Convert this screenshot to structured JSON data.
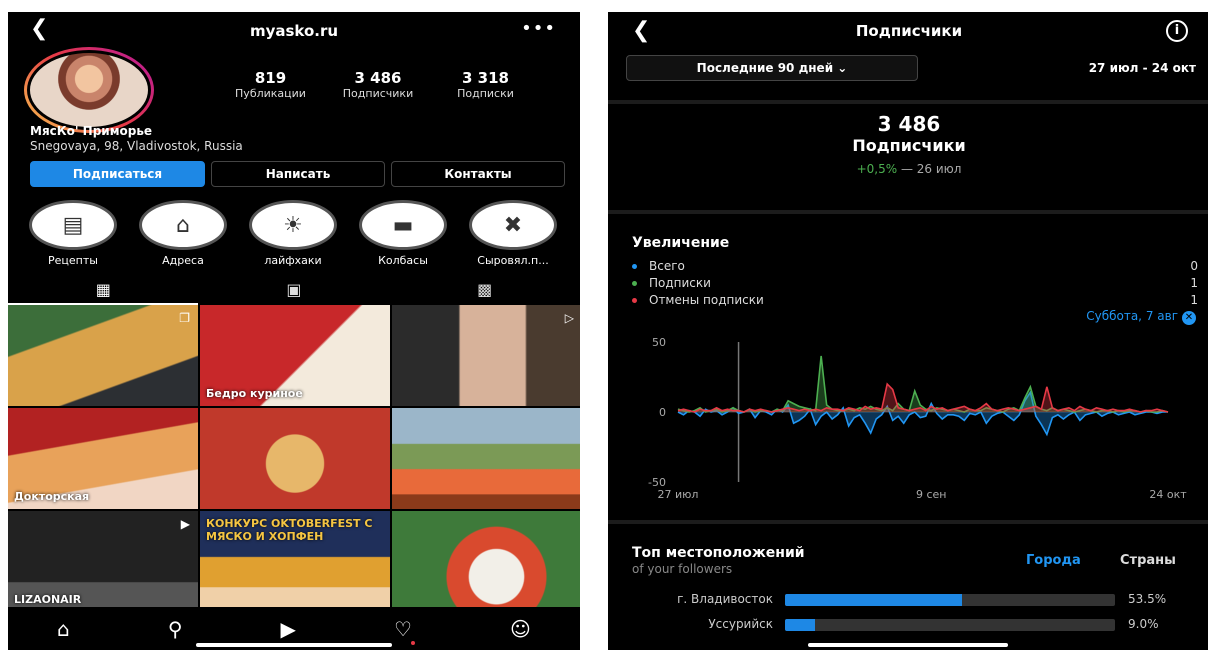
{
  "profile": {
    "username": "myasko.ru",
    "stats": [
      {
        "value": "819",
        "label": "Публикации"
      },
      {
        "value": "3 486",
        "label": "Подписчики"
      },
      {
        "value": "3 318",
        "label": "Подписки"
      }
    ],
    "name": "МясКо' Приморье",
    "address": "Snegovaya, 98, Vladivostok, Russia",
    "buttons": {
      "follow": "Подписаться",
      "message": "Написать",
      "contacts": "Контакты"
    },
    "highlights": [
      {
        "label": "Рецепты",
        "icon": "book-icon"
      },
      {
        "label": "Адреса",
        "icon": "home-icon"
      },
      {
        "label": "лайфхаки",
        "icon": "lightbulb-icon"
      },
      {
        "label": "Колбасы",
        "icon": "sausage-icon"
      },
      {
        "label": "Сыровял.п...",
        "icon": "cross-icon"
      }
    ],
    "tiles": [
      {
        "caption": "",
        "badge": "multi-icon"
      },
      {
        "caption": "Бедро куриное",
        "badge": ""
      },
      {
        "caption": "",
        "badge": "reel-icon"
      },
      {
        "caption": "Докторская",
        "badge": ""
      },
      {
        "caption": "",
        "badge": ""
      },
      {
        "caption": "",
        "badge": ""
      },
      {
        "caption": "LIZAONAIR",
        "badge": "play-icon"
      },
      {
        "caption": "КОНКУРС OKTOBERFEST С МЯСКО И ХОПФЕН",
        "badge": ""
      },
      {
        "caption": "",
        "badge": ""
      }
    ]
  },
  "followers": {
    "title": "Подписчики",
    "period": "Последние 90 дней ⌄",
    "range": "27 июл - 24 окт",
    "total": "3 486",
    "total_label": "Подписчики",
    "delta": "+0,5%",
    "delta_suffix": " — 26 июл",
    "growth_title": "Увеличение",
    "legend": [
      {
        "label": "Всего",
        "value": "0",
        "color": "#2196f3"
      },
      {
        "label": "Подписки",
        "value": "1",
        "color": "#4caf50"
      },
      {
        "label": "Отмены подписки",
        "value": "1",
        "color": "#e63946"
      }
    ],
    "selected_date": "Суббота, 7 авг",
    "locations_title": "Топ местоположений",
    "locations_subtitle": "of your followers",
    "location_tabs": [
      "Города",
      "Страны"
    ],
    "locations": [
      {
        "name": "г. Владивосток",
        "pct": "53.5%",
        "value": 53.5
      },
      {
        "name": "Уссурийск",
        "pct": "9.0%",
        "value": 9.0
      }
    ]
  },
  "chart_data": {
    "type": "line",
    "xlabel": "",
    "ylabel": "",
    "x_ticks": [
      "27 июл",
      "9 сен",
      "24 окт"
    ],
    "y_ticks": [
      "50",
      "0",
      "-50"
    ],
    "ylim": [
      -50,
      50
    ],
    "x": [
      1,
      2,
      3,
      4,
      5,
      6,
      7,
      8,
      9,
      10,
      11,
      12,
      13,
      14,
      15,
      16,
      17,
      18,
      19,
      20,
      21,
      22,
      23,
      24,
      25,
      26,
      27,
      28,
      29,
      30,
      31,
      32,
      33,
      34,
      35,
      36,
      37,
      38,
      39,
      40,
      41,
      42,
      43,
      44,
      45,
      46,
      47,
      48,
      49,
      50,
      51,
      52,
      53,
      54,
      55,
      56,
      57,
      58,
      59,
      60,
      61,
      62,
      63,
      64,
      65,
      66,
      67,
      68,
      69,
      70,
      71,
      72,
      73,
      74,
      75,
      76,
      77,
      78,
      79,
      80,
      81,
      82,
      83,
      84,
      85,
      86,
      87,
      88,
      89,
      90
    ],
    "series": [
      {
        "name": "Всего",
        "color": "#2196f3",
        "values": [
          0,
          -2,
          1,
          0,
          -3,
          2,
          0,
          1,
          -2,
          0,
          3,
          -1,
          0,
          2,
          -4,
          1,
          0,
          -2,
          2,
          0,
          5,
          -8,
          -6,
          -3,
          2,
          -9,
          -3,
          0,
          -5,
          -2,
          3,
          -10,
          -4,
          -2,
          -8,
          -15,
          -5,
          -2,
          4,
          -6,
          -3,
          -8,
          -2,
          0,
          -4,
          -3,
          6,
          -1,
          -5,
          -2,
          -2,
          -3,
          -6,
          -1,
          -2,
          0,
          -8,
          -3,
          -1,
          0,
          -3,
          -6,
          -2,
          8,
          14,
          -3,
          -9,
          -16,
          -4,
          -2,
          -5,
          -2,
          0,
          -6,
          -2,
          -1,
          0,
          -3,
          -1,
          0,
          -2,
          -1,
          0,
          -2,
          -1,
          0,
          0,
          -1,
          0,
          0
        ]
      },
      {
        "name": "Подписки",
        "color": "#4caf50",
        "values": [
          2,
          1,
          0,
          1,
          3,
          0,
          1,
          2,
          0,
          1,
          3,
          1,
          0,
          2,
          0,
          1,
          1,
          0,
          2,
          1,
          8,
          6,
          4,
          3,
          2,
          1,
          40,
          5,
          2,
          1,
          1,
          2,
          1,
          3,
          2,
          4,
          2,
          1,
          3,
          1,
          6,
          2,
          1,
          15,
          5,
          2,
          1,
          3,
          2,
          1,
          2,
          1,
          0,
          2,
          1,
          1,
          3,
          2,
          1,
          0,
          2,
          3,
          1,
          10,
          18,
          4,
          2,
          1,
          3,
          1,
          2,
          1,
          0,
          1,
          2,
          1,
          0,
          1,
          1,
          0,
          1,
          0,
          1,
          1,
          0,
          1,
          0,
          0,
          1,
          0
        ]
      },
      {
        "name": "Отмены подписки",
        "color": "#e63946",
        "values": [
          1,
          2,
          1,
          0,
          2,
          1,
          1,
          3,
          1,
          2,
          1,
          1,
          0,
          2,
          1,
          2,
          1,
          0,
          1,
          2,
          3,
          2,
          1,
          2,
          1,
          2,
          1,
          3,
          2,
          2,
          1,
          3,
          2,
          1,
          4,
          2,
          3,
          2,
          20,
          16,
          3,
          2,
          1,
          2,
          3,
          1,
          4,
          2,
          3,
          1,
          2,
          3,
          4,
          2,
          1,
          3,
          6,
          2,
          1,
          2,
          3,
          2,
          1,
          2,
          3,
          4,
          2,
          18,
          3,
          1,
          2,
          3,
          1,
          4,
          2,
          1,
          3,
          2,
          1,
          2,
          1,
          1,
          2,
          1,
          0,
          1,
          1,
          2,
          1,
          0
        ]
      }
    ],
    "selected_x": 12
  }
}
